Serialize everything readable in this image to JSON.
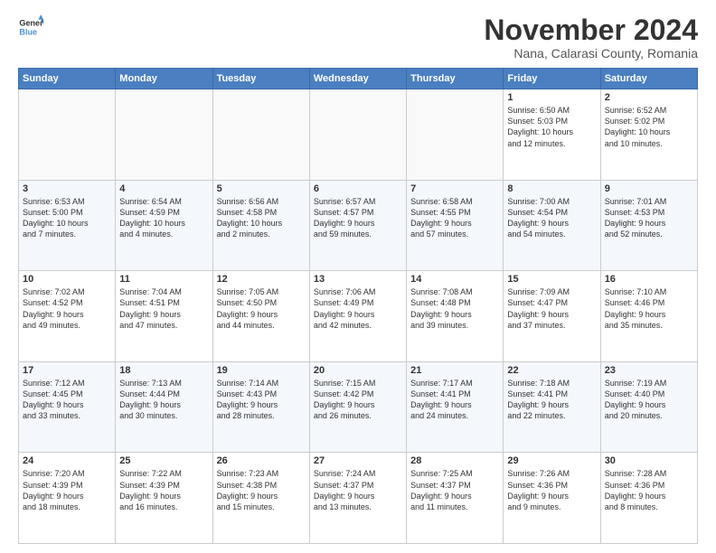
{
  "logo": {
    "line1": "General",
    "line2": "Blue"
  },
  "title": "November 2024",
  "subtitle": "Nana, Calarasi County, Romania",
  "days_of_week": [
    "Sunday",
    "Monday",
    "Tuesday",
    "Wednesday",
    "Thursday",
    "Friday",
    "Saturday"
  ],
  "weeks": [
    [
      {
        "day": "",
        "info": ""
      },
      {
        "day": "",
        "info": ""
      },
      {
        "day": "",
        "info": ""
      },
      {
        "day": "",
        "info": ""
      },
      {
        "day": "",
        "info": ""
      },
      {
        "day": "1",
        "info": "Sunrise: 6:50 AM\nSunset: 5:03 PM\nDaylight: 10 hours\nand 12 minutes."
      },
      {
        "day": "2",
        "info": "Sunrise: 6:52 AM\nSunset: 5:02 PM\nDaylight: 10 hours\nand 10 minutes."
      }
    ],
    [
      {
        "day": "3",
        "info": "Sunrise: 6:53 AM\nSunset: 5:00 PM\nDaylight: 10 hours\nand 7 minutes."
      },
      {
        "day": "4",
        "info": "Sunrise: 6:54 AM\nSunset: 4:59 PM\nDaylight: 10 hours\nand 4 minutes."
      },
      {
        "day": "5",
        "info": "Sunrise: 6:56 AM\nSunset: 4:58 PM\nDaylight: 10 hours\nand 2 minutes."
      },
      {
        "day": "6",
        "info": "Sunrise: 6:57 AM\nSunset: 4:57 PM\nDaylight: 9 hours\nand 59 minutes."
      },
      {
        "day": "7",
        "info": "Sunrise: 6:58 AM\nSunset: 4:55 PM\nDaylight: 9 hours\nand 57 minutes."
      },
      {
        "day": "8",
        "info": "Sunrise: 7:00 AM\nSunset: 4:54 PM\nDaylight: 9 hours\nand 54 minutes."
      },
      {
        "day": "9",
        "info": "Sunrise: 7:01 AM\nSunset: 4:53 PM\nDaylight: 9 hours\nand 52 minutes."
      }
    ],
    [
      {
        "day": "10",
        "info": "Sunrise: 7:02 AM\nSunset: 4:52 PM\nDaylight: 9 hours\nand 49 minutes."
      },
      {
        "day": "11",
        "info": "Sunrise: 7:04 AM\nSunset: 4:51 PM\nDaylight: 9 hours\nand 47 minutes."
      },
      {
        "day": "12",
        "info": "Sunrise: 7:05 AM\nSunset: 4:50 PM\nDaylight: 9 hours\nand 44 minutes."
      },
      {
        "day": "13",
        "info": "Sunrise: 7:06 AM\nSunset: 4:49 PM\nDaylight: 9 hours\nand 42 minutes."
      },
      {
        "day": "14",
        "info": "Sunrise: 7:08 AM\nSunset: 4:48 PM\nDaylight: 9 hours\nand 39 minutes."
      },
      {
        "day": "15",
        "info": "Sunrise: 7:09 AM\nSunset: 4:47 PM\nDaylight: 9 hours\nand 37 minutes."
      },
      {
        "day": "16",
        "info": "Sunrise: 7:10 AM\nSunset: 4:46 PM\nDaylight: 9 hours\nand 35 minutes."
      }
    ],
    [
      {
        "day": "17",
        "info": "Sunrise: 7:12 AM\nSunset: 4:45 PM\nDaylight: 9 hours\nand 33 minutes."
      },
      {
        "day": "18",
        "info": "Sunrise: 7:13 AM\nSunset: 4:44 PM\nDaylight: 9 hours\nand 30 minutes."
      },
      {
        "day": "19",
        "info": "Sunrise: 7:14 AM\nSunset: 4:43 PM\nDaylight: 9 hours\nand 28 minutes."
      },
      {
        "day": "20",
        "info": "Sunrise: 7:15 AM\nSunset: 4:42 PM\nDaylight: 9 hours\nand 26 minutes."
      },
      {
        "day": "21",
        "info": "Sunrise: 7:17 AM\nSunset: 4:41 PM\nDaylight: 9 hours\nand 24 minutes."
      },
      {
        "day": "22",
        "info": "Sunrise: 7:18 AM\nSunset: 4:41 PM\nDaylight: 9 hours\nand 22 minutes."
      },
      {
        "day": "23",
        "info": "Sunrise: 7:19 AM\nSunset: 4:40 PM\nDaylight: 9 hours\nand 20 minutes."
      }
    ],
    [
      {
        "day": "24",
        "info": "Sunrise: 7:20 AM\nSunset: 4:39 PM\nDaylight: 9 hours\nand 18 minutes."
      },
      {
        "day": "25",
        "info": "Sunrise: 7:22 AM\nSunset: 4:39 PM\nDaylight: 9 hours\nand 16 minutes."
      },
      {
        "day": "26",
        "info": "Sunrise: 7:23 AM\nSunset: 4:38 PM\nDaylight: 9 hours\nand 15 minutes."
      },
      {
        "day": "27",
        "info": "Sunrise: 7:24 AM\nSunset: 4:37 PM\nDaylight: 9 hours\nand 13 minutes."
      },
      {
        "day": "28",
        "info": "Sunrise: 7:25 AM\nSunset: 4:37 PM\nDaylight: 9 hours\nand 11 minutes."
      },
      {
        "day": "29",
        "info": "Sunrise: 7:26 AM\nSunset: 4:36 PM\nDaylight: 9 hours\nand 9 minutes."
      },
      {
        "day": "30",
        "info": "Sunrise: 7:28 AM\nSunset: 4:36 PM\nDaylight: 9 hours\nand 8 minutes."
      }
    ]
  ]
}
